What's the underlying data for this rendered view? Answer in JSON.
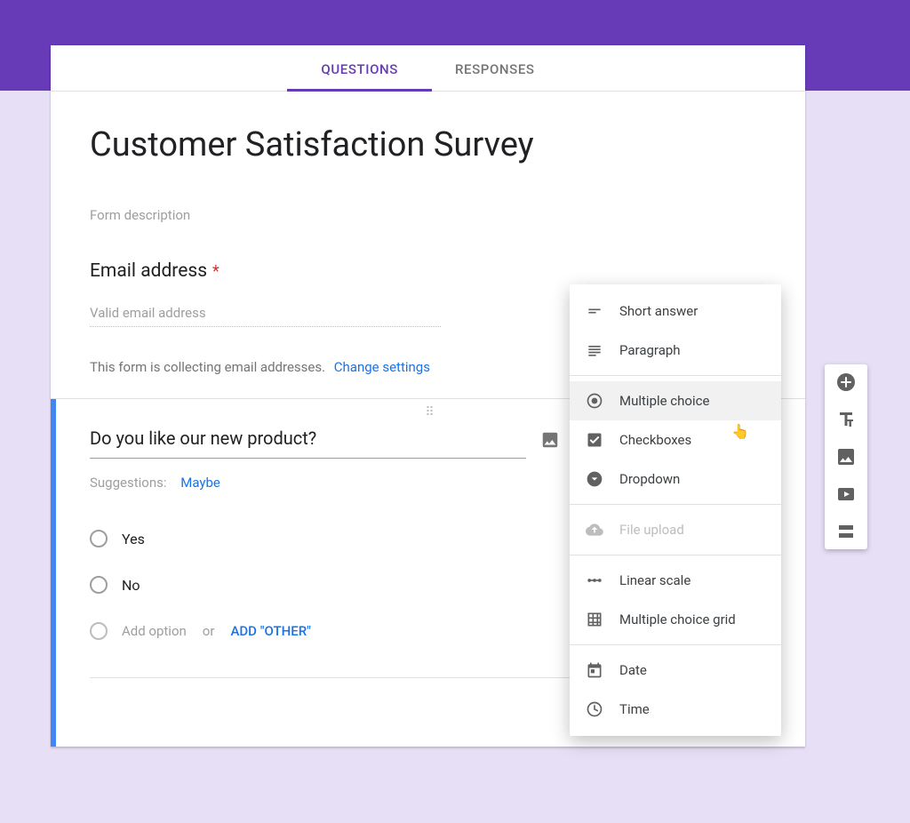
{
  "tabs": {
    "questions": "QUESTIONS",
    "responses": "RESPONSES",
    "active": "questions"
  },
  "form": {
    "title": "Customer Satisfaction Survey",
    "description_placeholder": "Form description",
    "email_question_label": "Email address",
    "email_placeholder": "Valid email address",
    "email_collect_note": "This form is collecting email addresses.",
    "change_settings_label": "Change settings"
  },
  "question": {
    "title": "Do you like our new product?",
    "suggestions_label": "Suggestions:",
    "suggestion_chip": "Maybe",
    "options": [
      "Yes",
      "No"
    ],
    "add_option_label": "Add option",
    "or_label": "or",
    "add_other_label": "ADD \"OTHER\""
  },
  "type_menu": {
    "items": [
      {
        "icon": "short-answer-icon",
        "label": "Short answer"
      },
      {
        "icon": "paragraph-icon",
        "label": "Paragraph"
      },
      {
        "sep": true
      },
      {
        "icon": "radio-icon",
        "label": "Multiple choice",
        "selected": true
      },
      {
        "icon": "checkbox-icon",
        "label": "Checkboxes"
      },
      {
        "icon": "dropdown-icon",
        "label": "Dropdown"
      },
      {
        "sep": true
      },
      {
        "icon": "file-upload-icon",
        "label": "File upload",
        "disabled": true
      },
      {
        "sep": true
      },
      {
        "icon": "linear-scale-icon",
        "label": "Linear scale"
      },
      {
        "icon": "grid-icon",
        "label": "Multiple choice grid"
      },
      {
        "sep": true
      },
      {
        "icon": "date-icon",
        "label": "Date"
      },
      {
        "icon": "time-icon",
        "label": "Time"
      }
    ]
  },
  "side_tools": [
    "add-question-icon",
    "add-title-icon",
    "add-image-icon",
    "add-video-icon",
    "add-section-icon"
  ]
}
